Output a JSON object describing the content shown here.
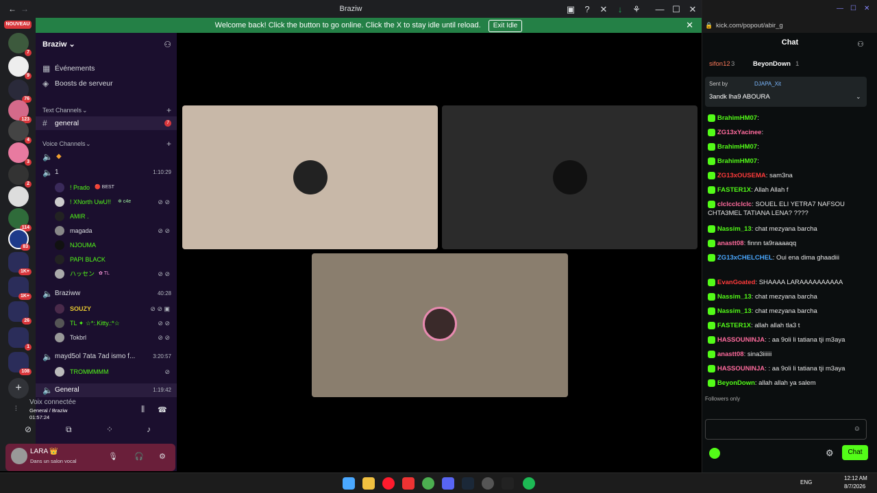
{
  "window": {
    "title": "Braziw"
  },
  "notice": {
    "text": "Welcome back! Click the button to go online. Click the X to stay idle until reload.",
    "button": "Exit Idle",
    "close": "✕"
  },
  "rail": {
    "nouveau": "NOUVEAU",
    "servers": [
      {
        "badge": "7"
      },
      {
        "badge": "9"
      },
      {
        "badge": "76"
      },
      {
        "badge": "123"
      },
      {
        "badge": "4"
      },
      {
        "badge": "3"
      },
      {
        "badge": "2"
      },
      {
        "badge": ""
      },
      {
        "badge": "114"
      },
      {
        "badge": "83"
      },
      {
        "badge": "1K+"
      },
      {
        "badge": "1K+"
      },
      {
        "badge": "26"
      },
      {
        "badge": "1"
      },
      {
        "badge": "108"
      }
    ]
  },
  "server": {
    "name": "Braziw",
    "events": "Événements",
    "boosts": "Boosts de serveur",
    "text_category": "Text Channels",
    "voice_category": "Voice Channels",
    "general_channel": "general",
    "general_badge": "7",
    "voice_channels": [
      {
        "name": "1",
        "time": "1:10:29"
      },
      {
        "name": "Braziww",
        "time": "40:28"
      },
      {
        "name": "mayd5ol 7ata 7ad ismo f...",
        "time": "3:20:57"
      },
      {
        "name": "General",
        "time": "1:19:42"
      }
    ],
    "users_ch1": [
      "! Prado",
      "! XNorth UwU!!",
      "AMIR .",
      "magada",
      "NJOUMA",
      "PAPI BLACK",
      "ハッセン"
    ],
    "user_tags": {
      "prado": "BEST",
      "xnorth": "c4e",
      "hassen": "TL"
    },
    "users_ch2": [
      "SOUZY",
      "TL ✦ ☆*:.Kitty.:*☆",
      "Tokbrl"
    ],
    "users_ch3": [
      "TROMMMMM"
    ]
  },
  "voice": {
    "status": "Voix connectée",
    "location": "General / Braziw",
    "time": "01:57:24"
  },
  "user": {
    "name": "LARA",
    "status": "Dans un salon vocal"
  },
  "chat": {
    "url": "kick.com/popout/abir_g",
    "title": "Chat",
    "top_user1": "sifon12",
    "top_count1": "3",
    "top_user2": "BeyonDown",
    "top_count2": "1",
    "pinned_by_label": "Sent by",
    "pinned_by": "DJAPA_Xit",
    "pinned_text": "3andk lha9 ABOURA",
    "messages": [
      {
        "user": "BrahimHM07",
        "text": "",
        "color": "#53fc18"
      },
      {
        "user": "ZG13xYacinee",
        "text": "",
        "color": "#ff6b9d"
      },
      {
        "user": "BrahimHM07",
        "text": "",
        "color": "#53fc18"
      },
      {
        "user": "BrahimHM07",
        "text": "",
        "color": "#53fc18"
      },
      {
        "user": "ZG13xOUSEMA",
        "text": "sam3na",
        "color": "#ff3b3b"
      },
      {
        "user": "FASTER1X",
        "text": "Allah Allah f",
        "color": "#53fc18"
      },
      {
        "user": "clclcclclclc",
        "text": "SOUEL ELI YETRA7 NAFSOU CHTA3MEL TATIANA LENA? ????",
        "color": "#ff6b9d"
      },
      {
        "user": "Nassim_13",
        "text": "chat mezyana barcha",
        "color": "#53fc18"
      },
      {
        "user": "anastt08",
        "text": "finnn ta9raaaaqq",
        "color": "#ff6b9d"
      },
      {
        "user": "ZG13xCHELCHEL",
        "text": "Oui ena dima ghaadiii",
        "color": "#4aa8ff"
      },
      {
        "user": "EvanGoated",
        "text": "SHAAAA LARAAAAAAAAAA",
        "color": "#ff3b3b"
      },
      {
        "user": "Nassim_13",
        "text": "chat mezyana barcha",
        "color": "#53fc18"
      },
      {
        "user": "Nassim_13",
        "text": "chat mezyana barcha",
        "color": "#53fc18"
      },
      {
        "user": "FASTER1X",
        "text": "allah allah tla3 t",
        "color": "#53fc18"
      },
      {
        "user": "HASSOUNINJA",
        "text": ": aa 9oli li tatiana tji m3aya",
        "color": "#ff6b9d"
      },
      {
        "user": "anastt08",
        "text": "sina3iiiiii",
        "color": "#ff6b9d"
      },
      {
        "user": "HASSOUNINJA",
        "text": ": aa 9oli li tatiana tji m3aya",
        "color": "#ff6b9d"
      },
      {
        "user": "BeyonDown",
        "text": "allah allah ya salem",
        "color": "#53fc18"
      }
    ],
    "followers_only": "Followers only",
    "send_button": "Chat"
  },
  "taskbar": {
    "lang": "ENG",
    "time": "12:12 AM",
    "date": "8/7/2026"
  },
  "colors": {
    "accent": "#53fc18",
    "discord_green": "#248046",
    "sidebar": "#1b0f2e"
  }
}
